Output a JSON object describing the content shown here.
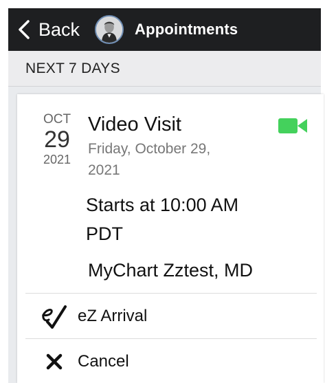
{
  "header": {
    "back_label": "Back",
    "title": "Appointments",
    "bg_color": "#1e1f21"
  },
  "section": {
    "label": "NEXT 7 DAYS"
  },
  "appointment": {
    "month": "OCT",
    "day": "29",
    "year": "2021",
    "title": "Video Visit",
    "date_text": "Friday, October 29, 2021",
    "start_time": "Starts at 10:00 AM PDT",
    "provider": "MyChart Zztest, MD",
    "visit_icon": "video-camera-icon",
    "visit_icon_color": "#44d15c"
  },
  "actions": {
    "arrival": {
      "label": "eZ Arrival",
      "icon": "ez-arrival-icon"
    },
    "cancel": {
      "label": "Cancel",
      "icon": "close-icon"
    }
  }
}
